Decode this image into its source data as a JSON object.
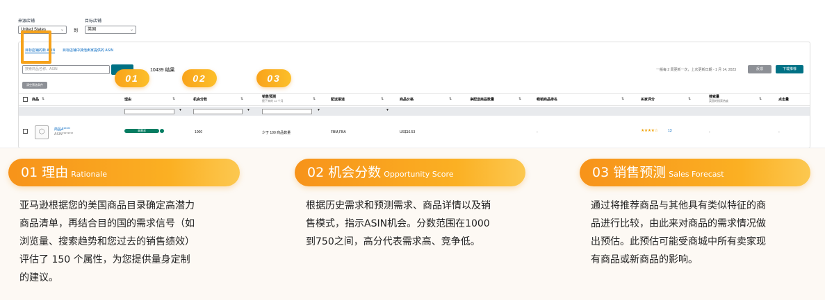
{
  "screenshot": {
    "source_store_label": "来源店铺",
    "source_store_value": "United States",
    "to_word": "到",
    "target_store_label": "目标店铺",
    "target_store_value": "英国",
    "tabs": [
      {
        "label": "目标店铺的新 ASIN",
        "active": true
      },
      {
        "label": "目标店铺中其他卖家提供的 ASIN",
        "active": false
      }
    ],
    "search_placeholder": "搜索商品名称、ASIN",
    "result_count": "10439 结果",
    "update_note": "一般每 2 周更新一次，上次更新日期 - 1 月 14, 2023",
    "feedback_button": "反馈",
    "download_button": "下载推荐",
    "filter_button": "清空筛选条件",
    "columns": [
      {
        "label": "商品",
        "sub": ""
      },
      {
        "label": "理由",
        "sub": ""
      },
      {
        "label": "机会分数",
        "sub": ""
      },
      {
        "label": "销售预测",
        "sub": "接下来的 12 个月"
      },
      {
        "label": "配送渠道",
        "sub": ""
      },
      {
        "label": "商品价格",
        "sub": ""
      },
      {
        "label": "净配送商品数量",
        "sub": ""
      },
      {
        "label": "畅销商品排名",
        "sub": ""
      },
      {
        "label": "买家评分",
        "sub": ""
      },
      {
        "label": "搜索量",
        "sub": "英国的搜索热度"
      },
      {
        "label": "点击量",
        "sub": ""
      }
    ],
    "row": {
      "name": "商品A*****",
      "asin": "ASIN********",
      "reason": "高需求",
      "score": "1000",
      "forecast": "少于 100 商品数量",
      "channel": "FBM,FBA",
      "price": "US$16.53",
      "bsr": "-",
      "rating_stars": "★★★★☆",
      "rating": 4,
      "rating_count": "13",
      "search": "-",
      "clicks": "-"
    },
    "badges": [
      "01",
      "02",
      "03"
    ]
  },
  "sections": [
    {
      "title_cn": "01 理由",
      "title_en": "Rationale",
      "lines": [
        "亚马逊根据您的美国商品目录确定高潜力",
        "商品清单，再结合目的国的需求信号（如",
        "浏览量、搜索趋势和您过去的销售绩效）",
        "评估了 150 个属性，为您提供量身定制",
        "的建议。"
      ]
    },
    {
      "title_cn": "02 机会分数",
      "title_en": "Opportunity Score",
      "lines": [
        "根据历史需求和预测需求、商品详情以及销",
        "售模式，指示ASIN机会。分数范围在1000",
        "到750之间，高分代表需求高、竞争低。"
      ]
    },
    {
      "title_cn": "03 销售预测",
      "title_en": "Sales Forecast",
      "lines": [
        "通过将推荐商品与其他具有类似特征的商",
        "品进行比较，由此来对商品的需求情况做",
        "出预估。此预估可能受商城中所有卖家现",
        "有商品或新商品的影响。"
      ]
    }
  ],
  "colors": {
    "accent_orange": "#f7931a",
    "teal": "#007185",
    "link_blue": "#0066c0",
    "pill_green": "#067d62"
  }
}
